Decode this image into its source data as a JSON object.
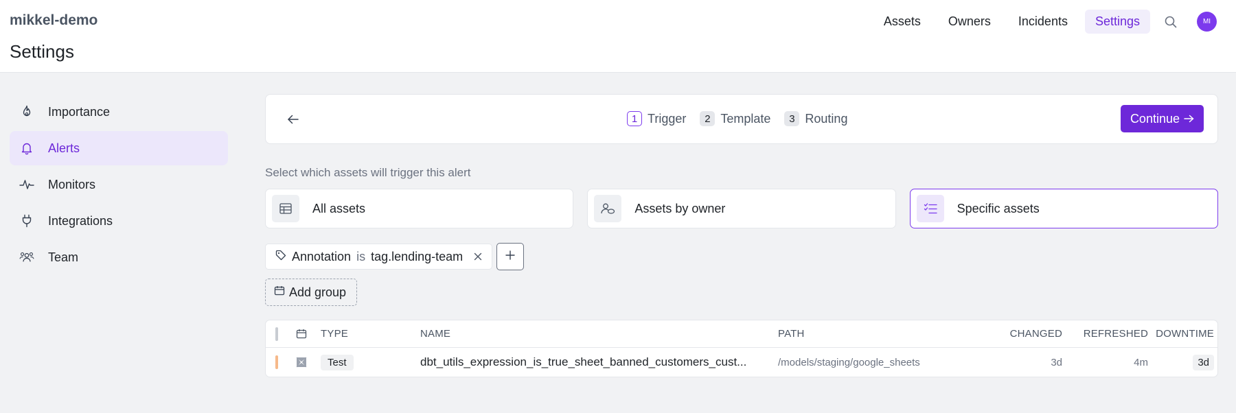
{
  "header": {
    "org_name": "mikkel-demo",
    "page_title": "Settings",
    "nav": [
      {
        "label": "Assets"
      },
      {
        "label": "Owners"
      },
      {
        "label": "Incidents"
      },
      {
        "label": "Settings",
        "active": true
      }
    ],
    "search_icon": "search-icon",
    "avatar_initials": "MI"
  },
  "sidebar": {
    "items": [
      {
        "label": "Importance",
        "icon": "flame-icon"
      },
      {
        "label": "Alerts",
        "icon": "bell-icon",
        "active": true
      },
      {
        "label": "Monitors",
        "icon": "pulse-icon"
      },
      {
        "label": "Integrations",
        "icon": "plug-icon"
      },
      {
        "label": "Team",
        "icon": "users-icon"
      }
    ]
  },
  "stepper": {
    "steps": [
      {
        "num": "1",
        "label": "Trigger",
        "active": true
      },
      {
        "num": "2",
        "label": "Template"
      },
      {
        "num": "3",
        "label": "Routing"
      }
    ],
    "continue_label": "Continue"
  },
  "trigger": {
    "prompt": "Select which assets will trigger this alert",
    "options": [
      {
        "label": "All assets",
        "icon": "table-icon"
      },
      {
        "label": "Assets by owner",
        "icon": "owner-icon"
      },
      {
        "label": "Specific assets",
        "icon": "checklist-icon",
        "selected": true
      }
    ],
    "filter": {
      "field": "Annotation",
      "operator": "is",
      "value": "tag.lending-team"
    },
    "add_group_label": "Add group"
  },
  "table": {
    "columns": [
      "TYPE",
      "NAME",
      "PATH",
      "CHANGED",
      "REFRESHED",
      "DOWNTIME"
    ],
    "rows": [
      {
        "type": "Test",
        "name": "dbt_utils_expression_is_true_sheet_banned_customers_cust...",
        "path": "/models/staging/google_sheets",
        "changed": "3d",
        "refreshed": "4m",
        "downtime": "3d"
      }
    ]
  },
  "colors": {
    "accent": "#6d28d9",
    "accent_bg": "#ece7fb",
    "status_bar": "#f6b98a"
  }
}
